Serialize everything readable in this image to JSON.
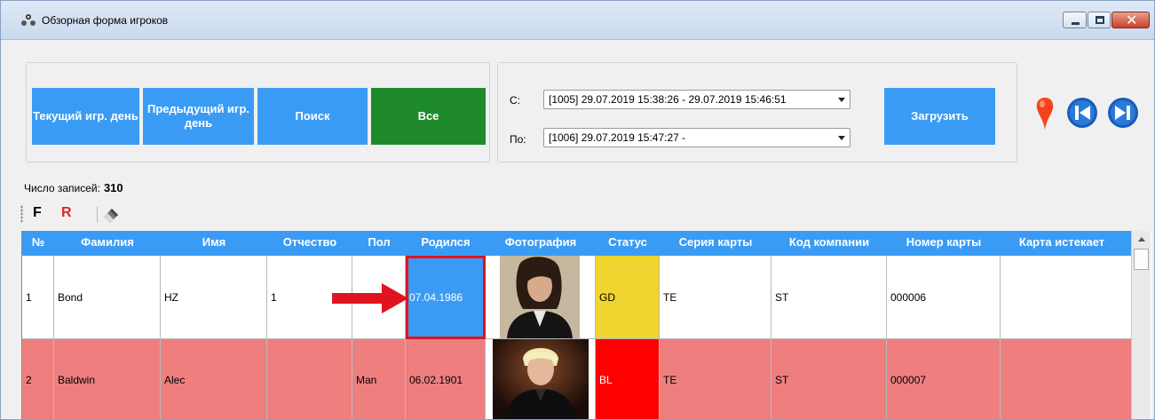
{
  "window": {
    "title": "Обзорная форма игроков",
    "close_glyph": "✕"
  },
  "buttons": {
    "current_day": "Текущий игр. день",
    "previous_day": "Предыдущий игр. день",
    "search": "Поиск",
    "all": "Все",
    "load": "Загрузить"
  },
  "range": {
    "from_label": "С:",
    "to_label": "По:",
    "from_value": "[1005] 29.07.2019 15:38:26 - 29.07.2019 15:46:51",
    "to_value": "[1006] 29.07.2019 15:47:27 -"
  },
  "records": {
    "label": "Число записей:",
    "count": "310"
  },
  "toolbar": {
    "f_label": "F",
    "r_label": "R"
  },
  "table": {
    "columns": [
      "№",
      "Фамилия",
      "Имя",
      "Отчество",
      "Пол",
      "Родился",
      "Фотография",
      "Статус",
      "Серия карты",
      "Код компании",
      "Номер карты",
      "Карта истекает"
    ],
    "rows": [
      {
        "num": "1",
        "surname": "Bond",
        "name": "HZ",
        "patronymic": "1",
        "sex": "",
        "born": "07.04.1986",
        "status": "GD",
        "card_series": "TE",
        "company_code": "ST",
        "card_number": "000006",
        "card_expires": ""
      },
      {
        "num": "2",
        "surname": "Baldwin",
        "name": "Alec",
        "patronymic": "",
        "sex": "Man",
        "born": "06.02.1901",
        "status": "BL",
        "card_series": "TE",
        "company_code": "ST",
        "card_number": "000007",
        "card_expires": ""
      }
    ]
  },
  "colors": {
    "accent_blue": "#3a9bf5",
    "all_green": "#1e8a2b",
    "row_blocked": "#ef7f7f",
    "status_gd": "#f0d430",
    "status_bl": "#ff0000",
    "highlight_red": "#e0141e"
  },
  "icons": {
    "title": "players-form-icon",
    "marker": "map-pin-icon",
    "prev": "skip-back-icon",
    "next": "skip-forward-icon",
    "eraser": "eraser-icon"
  }
}
